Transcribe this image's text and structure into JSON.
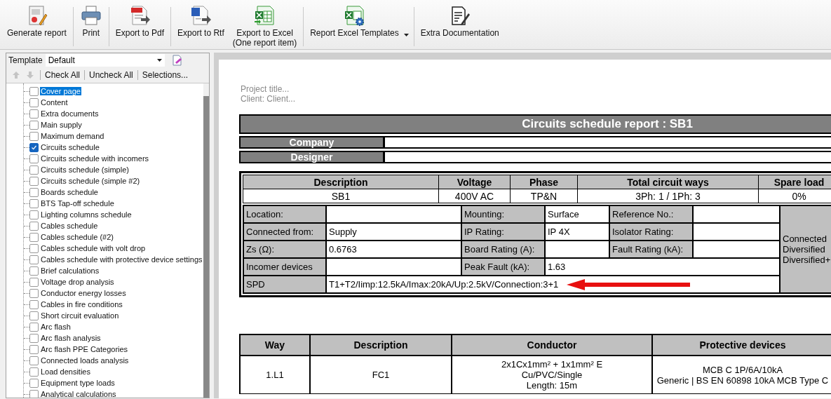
{
  "toolbar": [
    {
      "label": "Generate report",
      "kind": "generate",
      "separator_before": false,
      "has_menu": false
    },
    {
      "label": "Print",
      "kind": "print",
      "separator_before": true,
      "has_menu": false
    },
    {
      "label": "Export to Pdf",
      "kind": "pdf",
      "separator_before": true,
      "has_menu": false
    },
    {
      "label": "Export to Rtf",
      "kind": "rtf",
      "separator_before": true,
      "has_menu": false
    },
    {
      "label": "Export to Excel\n(One report item)",
      "kind": "excel",
      "separator_before": false,
      "has_menu": false
    },
    {
      "label": "Report Excel Templates",
      "kind": "excel-templates",
      "separator_before": true,
      "has_menu": true
    },
    {
      "label": "Extra Documentation",
      "kind": "documentation",
      "separator_before": true,
      "has_menu": false
    }
  ],
  "template": {
    "label": "Template",
    "value": "Default"
  },
  "order_buttons": [
    {
      "kind": "up",
      "disabled": true
    },
    {
      "kind": "down",
      "disabled": true
    }
  ],
  "list_actions": [
    "Check All",
    "Uncheck All",
    "Selections..."
  ],
  "tree": [
    {
      "label": "Cover page",
      "checked": false,
      "selected": true
    },
    {
      "label": "Content",
      "checked": false,
      "selected": false
    },
    {
      "label": "Extra documents",
      "checked": false,
      "selected": false
    },
    {
      "label": "Main supply",
      "checked": false,
      "selected": false
    },
    {
      "label": "Maximum demand",
      "checked": false,
      "selected": false
    },
    {
      "label": "Circuits schedule",
      "checked": true,
      "selected": false
    },
    {
      "label": "Circuits schedule with incomers",
      "checked": false,
      "selected": false
    },
    {
      "label": "Circuits schedule (simple)",
      "checked": false,
      "selected": false
    },
    {
      "label": "Circuits schedule (simple #2)",
      "checked": false,
      "selected": false
    },
    {
      "label": "Boards schedule",
      "checked": false,
      "selected": false
    },
    {
      "label": "BTS Tap-off schedule",
      "checked": false,
      "selected": false
    },
    {
      "label": "Lighting columns schedule",
      "checked": false,
      "selected": false
    },
    {
      "label": "Cables schedule",
      "checked": false,
      "selected": false
    },
    {
      "label": "Cables schedule (#2)",
      "checked": false,
      "selected": false
    },
    {
      "label": "Cables schedule with volt drop",
      "checked": false,
      "selected": false
    },
    {
      "label": "Cables schedule with protective device settings",
      "checked": false,
      "selected": false
    },
    {
      "label": "Brief calculations",
      "checked": false,
      "selected": false
    },
    {
      "label": "Voltage drop analysis",
      "checked": false,
      "selected": false
    },
    {
      "label": "Conductor energy losses",
      "checked": false,
      "selected": false
    },
    {
      "label": "Cables in fire conditions",
      "checked": false,
      "selected": false
    },
    {
      "label": "Short circuit evaluation",
      "checked": false,
      "selected": false
    },
    {
      "label": "Arc flash",
      "checked": false,
      "selected": false
    },
    {
      "label": "Arc flash analysis",
      "checked": false,
      "selected": false
    },
    {
      "label": "Arc flash PPE Categories",
      "checked": false,
      "selected": false
    },
    {
      "label": "Connected loads analysis",
      "checked": false,
      "selected": false
    },
    {
      "label": "Load densities",
      "checked": false,
      "selected": false
    },
    {
      "label": "Equipment type loads",
      "checked": false,
      "selected": false
    },
    {
      "label": "Analytical calculations",
      "checked": false,
      "selected": false
    }
  ],
  "report": {
    "header_lines": [
      "Project title...",
      "Client: Client..."
    ],
    "title": "Circuits schedule report : SB1",
    "fields": [
      "Company",
      "Designer"
    ],
    "summary": {
      "columns": [
        "Description",
        "Voltage",
        "Phase",
        "Total circuit ways",
        "Spare load"
      ],
      "row": [
        "SB1",
        "400V AC",
        "TP&N",
        "3Ph: 1 / 1Ph: 3",
        "0%"
      ]
    },
    "details": [
      [
        {
          "kind": "label",
          "text": "Location:"
        },
        {
          "kind": "value"
        },
        {
          "kind": "label",
          "text": "Mounting:"
        },
        {
          "kind": "value",
          "text": "Surface"
        },
        {
          "kind": "label",
          "text": "Reference No.:"
        },
        {
          "kind": "value"
        }
      ],
      [
        {
          "kind": "label",
          "text": "Connected from:"
        },
        {
          "kind": "value",
          "text": "Supply"
        },
        {
          "kind": "label",
          "text": "IP Rating:"
        },
        {
          "kind": "value",
          "text": "IP 4X"
        },
        {
          "kind": "label",
          "text": "Isolator Rating:"
        },
        {
          "kind": "value"
        }
      ],
      [
        {
          "kind": "label",
          "text": "Zs (Ω):"
        },
        {
          "kind": "value",
          "text": "0.6763"
        },
        {
          "kind": "label",
          "text": "Board Rating (A):"
        },
        {
          "kind": "value"
        },
        {
          "kind": "label",
          "text": "Fault Rating (kA):"
        },
        {
          "kind": "value"
        }
      ],
      [
        {
          "kind": "label",
          "text": "Incomer devices"
        },
        {
          "kind": "value"
        },
        {
          "kind": "label",
          "text": "Peak Fault (kA):"
        },
        {
          "kind": "value",
          "text": "1.63"
        }
      ],
      [
        {
          "kind": "label",
          "text": "SPD"
        },
        {
          "kind": "value",
          "text": "T1+T2/Iimp:12.5kA/Imax:20kA/Up:2.5kV/Connection:3+1",
          "arrow": true
        }
      ]
    ],
    "side_lines": [
      "Connected",
      "Diversified",
      "Diversified+"
    ],
    "circuits": {
      "columns": [
        "Way",
        "Description",
        "Conductor",
        "Protective devices"
      ],
      "rows": [
        {
          "way": "1.L1",
          "description": "FC1",
          "conductor": "2x1Cx1mm² + 1x1mm² E\nCu/PVC/Single\nLength: 15m",
          "protective": "MCB C 1P/6A/10kA\nGeneric | BS EN 60898 10kA MCB Type C"
        }
      ]
    }
  }
}
